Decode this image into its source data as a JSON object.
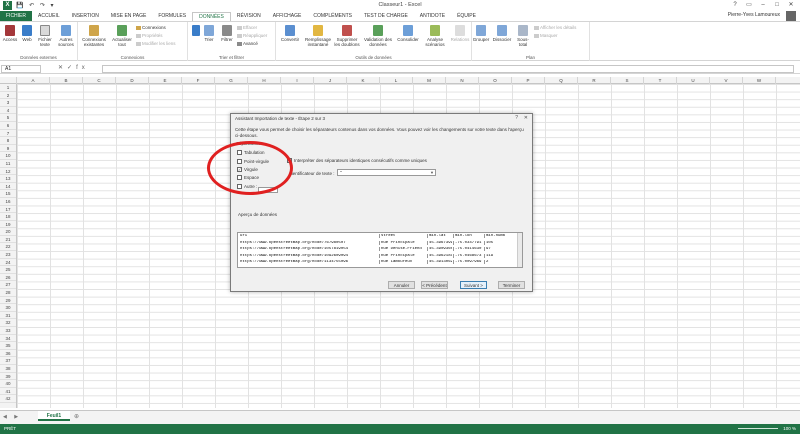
{
  "app": {
    "title": "Classeur1 - Excel",
    "user": "Pierre-Yves Lamoureux"
  },
  "tabs": [
    "FICHIER",
    "ACCUEIL",
    "INSERTION",
    "MISE EN PAGE",
    "FORMULES",
    "DONNÉES",
    "RÉVISION",
    "AFFICHAGE",
    "COMPLÉMENTS",
    "TEST DE CHARGE",
    "ANTIDOTE",
    "ÉQUIPE"
  ],
  "ribbon": {
    "g1": {
      "label": "Données externes",
      "b1": "Access",
      "b2": "Web",
      "b3": "Fichier texte",
      "b4": "Autres sources"
    },
    "g2": {
      "label": "Connexions",
      "b1": "Connexions existantes",
      "b2": "Actualiser tout",
      "s1": "Connexions",
      "s2": "Propriétés",
      "s3": "Modifier les liens"
    },
    "g3": {
      "label": "Trier et filtrer",
      "b1": "Trier",
      "b2": "Filtrer",
      "s1": "Effacer",
      "s2": "Réappliquer",
      "s3": "Avancé"
    },
    "g4": {
      "label": "Outils de données",
      "b1": "Convertir",
      "b2": "Remplissage instantané",
      "b3": "Supprimer les doublons",
      "b4": "Validation des données",
      "b5": "Consolider",
      "b6": "Analyse scénarios",
      "b7": "Relations"
    },
    "g5": {
      "label": "Plan",
      "b1": "Grouper",
      "b2": "Dissocier",
      "b3": "Sous-total",
      "s1": "Afficher les détails",
      "s2": "Masquer"
    }
  },
  "formula": {
    "namebox": "A1",
    "value": ""
  },
  "columns": [
    "A",
    "B",
    "C",
    "D",
    "E",
    "F",
    "G",
    "H",
    "I",
    "J",
    "K",
    "L",
    "M",
    "N",
    "O",
    "P",
    "Q",
    "R",
    "S",
    "T",
    "U",
    "V",
    "W"
  ],
  "rows": [
    "1",
    "2",
    "3",
    "4",
    "5",
    "6",
    "7",
    "8",
    "9",
    "10",
    "11",
    "12",
    "13",
    "14",
    "15",
    "16",
    "17",
    "18",
    "19",
    "20",
    "21",
    "22",
    "23",
    "24",
    "25",
    "26",
    "27",
    "28",
    "29",
    "30",
    "31",
    "32",
    "33",
    "34",
    "35",
    "36",
    "37",
    "38",
    "39",
    "40",
    "41",
    "42"
  ],
  "dialog": {
    "title": "Assistant Importation de texte - Étape 2 sur 3",
    "help": "?",
    "close": "✕",
    "intro": "Cette étape vous permet de choisir les séparateurs contenus dans vos données. Vous pouvez voir les changements sur votre texte dans l'aperçu ci-dessous.",
    "separators_label": "Séparateurs",
    "sep_tab": "Tabulation",
    "sep_semicolon": "Point-virgule",
    "sep_comma": "Virgule",
    "sep_space": "Espace",
    "sep_other": "Autre :",
    "consecutive": "Interpréter des séparateurs identiques consécutifs comme uniques",
    "qualifier_label": "Identificateur de texte :",
    "qualifier_value": "\"",
    "preview_label": "Aperçu de données",
    "preview_rows": [
      [
        "uri",
        "",
        "street",
        "min-lat",
        "min-lon",
        "min-numb"
      ],
      [
        "https://www.openstreetmap.org/node/767980507",
        "",
        "Rue Principale",
        "45.3967399",
        "-75.0347791",
        "105"
      ],
      [
        "https://www.openstreetmap.org/node/1057819054",
        "",
        "Rue Denise-Friend",
        "45.3909360",
        "-75.0414630",
        "97"
      ],
      [
        "https://www.openstreetmap.org/node/1092609094",
        "",
        "Rue Principale",
        "45.3962181",
        "-75.0468673",
        "119"
      ],
      [
        "https://www.openstreetmap.org/node/1134755096",
        "",
        "Rue Lamoureux",
        "45.3913062",
        "-75.0097969",
        "2"
      ]
    ],
    "btn_cancel": "Annuler",
    "btn_prev": "< Précédent",
    "btn_next": "Suivant >",
    "btn_finish": "Terminer"
  },
  "sheetbar": {
    "sheet": "Feuil1",
    "nav": "◀ ▶",
    "plus": "⊕"
  },
  "status": {
    "state": "PRÊT",
    "zoom": "100 %"
  },
  "colors": {
    "excel_green": "#217346",
    "annotation_red": "#e02020"
  }
}
